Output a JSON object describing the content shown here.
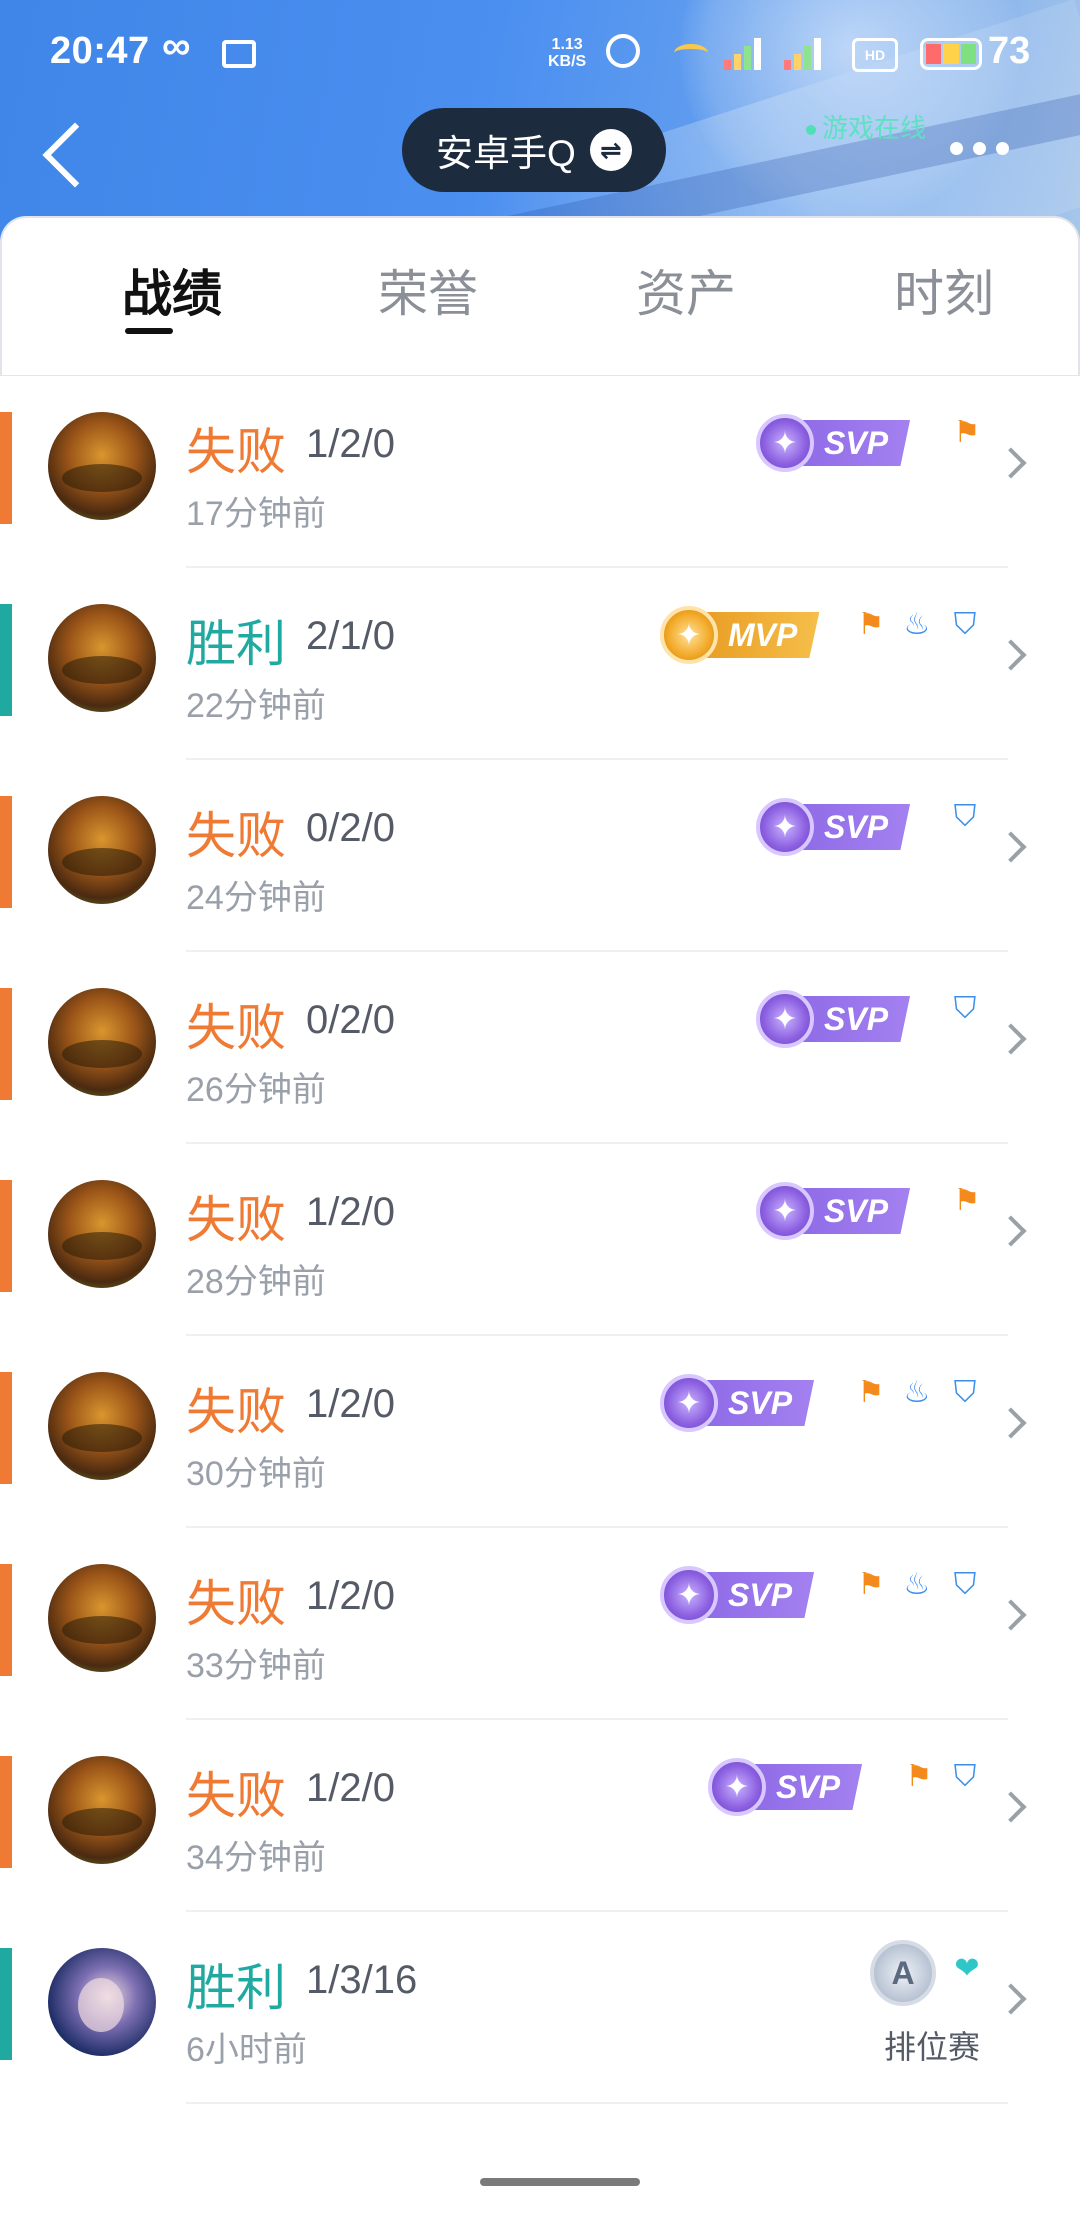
{
  "status_bar": {
    "time": "20:47",
    "net_speed_value": "1.13",
    "net_speed_unit": "KB/S",
    "hd_label": "HD",
    "battery": "73"
  },
  "header": {
    "account_name": "安卓手Q",
    "swap_symbol": "⇌",
    "online_status": "游戏在线"
  },
  "tabs": [
    {
      "label": "战绩",
      "active": true
    },
    {
      "label": "荣誉",
      "active": false
    },
    {
      "label": "资产",
      "active": false
    },
    {
      "label": "时刻",
      "active": false
    }
  ],
  "colors": {
    "loss": "#ef7a34",
    "win": "#1fa9a0",
    "header_blue": "#4b8ff0"
  },
  "matches": [
    {
      "result": "失败",
      "kda": "1/2/0",
      "time": "17分钟前",
      "badge": "SVP",
      "icons": [
        "flag-icon"
      ]
    },
    {
      "result": "胜利",
      "kda": "2/1/0",
      "time": "22分钟前",
      "badge": "MVP",
      "icons": [
        "flag-icon",
        "fire-icon",
        "shield-icon"
      ]
    },
    {
      "result": "失败",
      "kda": "0/2/0",
      "time": "24分钟前",
      "badge": "SVP",
      "icons": [
        "shield-icon"
      ]
    },
    {
      "result": "失败",
      "kda": "0/2/0",
      "time": "26分钟前",
      "badge": "SVP",
      "icons": [
        "shield-icon"
      ]
    },
    {
      "result": "失败",
      "kda": "1/2/0",
      "time": "28分钟前",
      "badge": "SVP",
      "icons": [
        "flag-icon"
      ]
    },
    {
      "result": "失败",
      "kda": "1/2/0",
      "time": "30分钟前",
      "badge": "SVP",
      "icons": [
        "flag-icon",
        "fire-icon",
        "shield-icon"
      ]
    },
    {
      "result": "失败",
      "kda": "1/2/0",
      "time": "33分钟前",
      "badge": "SVP",
      "icons": [
        "flag-icon",
        "fire-icon",
        "shield-icon"
      ]
    },
    {
      "result": "失败",
      "kda": "1/2/0",
      "time": "34分钟前",
      "badge": "SVP",
      "icons": [
        "flag-icon",
        "shield-icon"
      ]
    },
    {
      "result": "胜利",
      "kda": "1/3/16",
      "time": "6小时前",
      "rank_letter": "A",
      "mode": "排位赛",
      "icons": [
        "heart-icon"
      ]
    }
  ]
}
